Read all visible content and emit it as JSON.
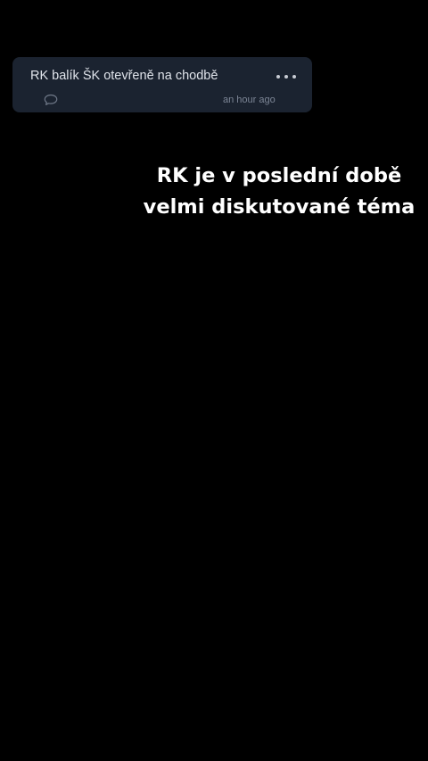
{
  "post": {
    "text": "RK balík ŠK otevřeně na chodbě",
    "more_icon": "more-horizontal-icon",
    "comment_icon": "comment-bubble-icon",
    "timestamp": "an hour ago"
  },
  "caption": {
    "line1": "RK je v poslední době",
    "line2": "velmi diskutované téma"
  },
  "colors": {
    "background": "#000000",
    "card": "#1b2330",
    "card_text": "#dfe3ea",
    "muted_text": "#7c8595",
    "caption_text": "#ffffff"
  }
}
